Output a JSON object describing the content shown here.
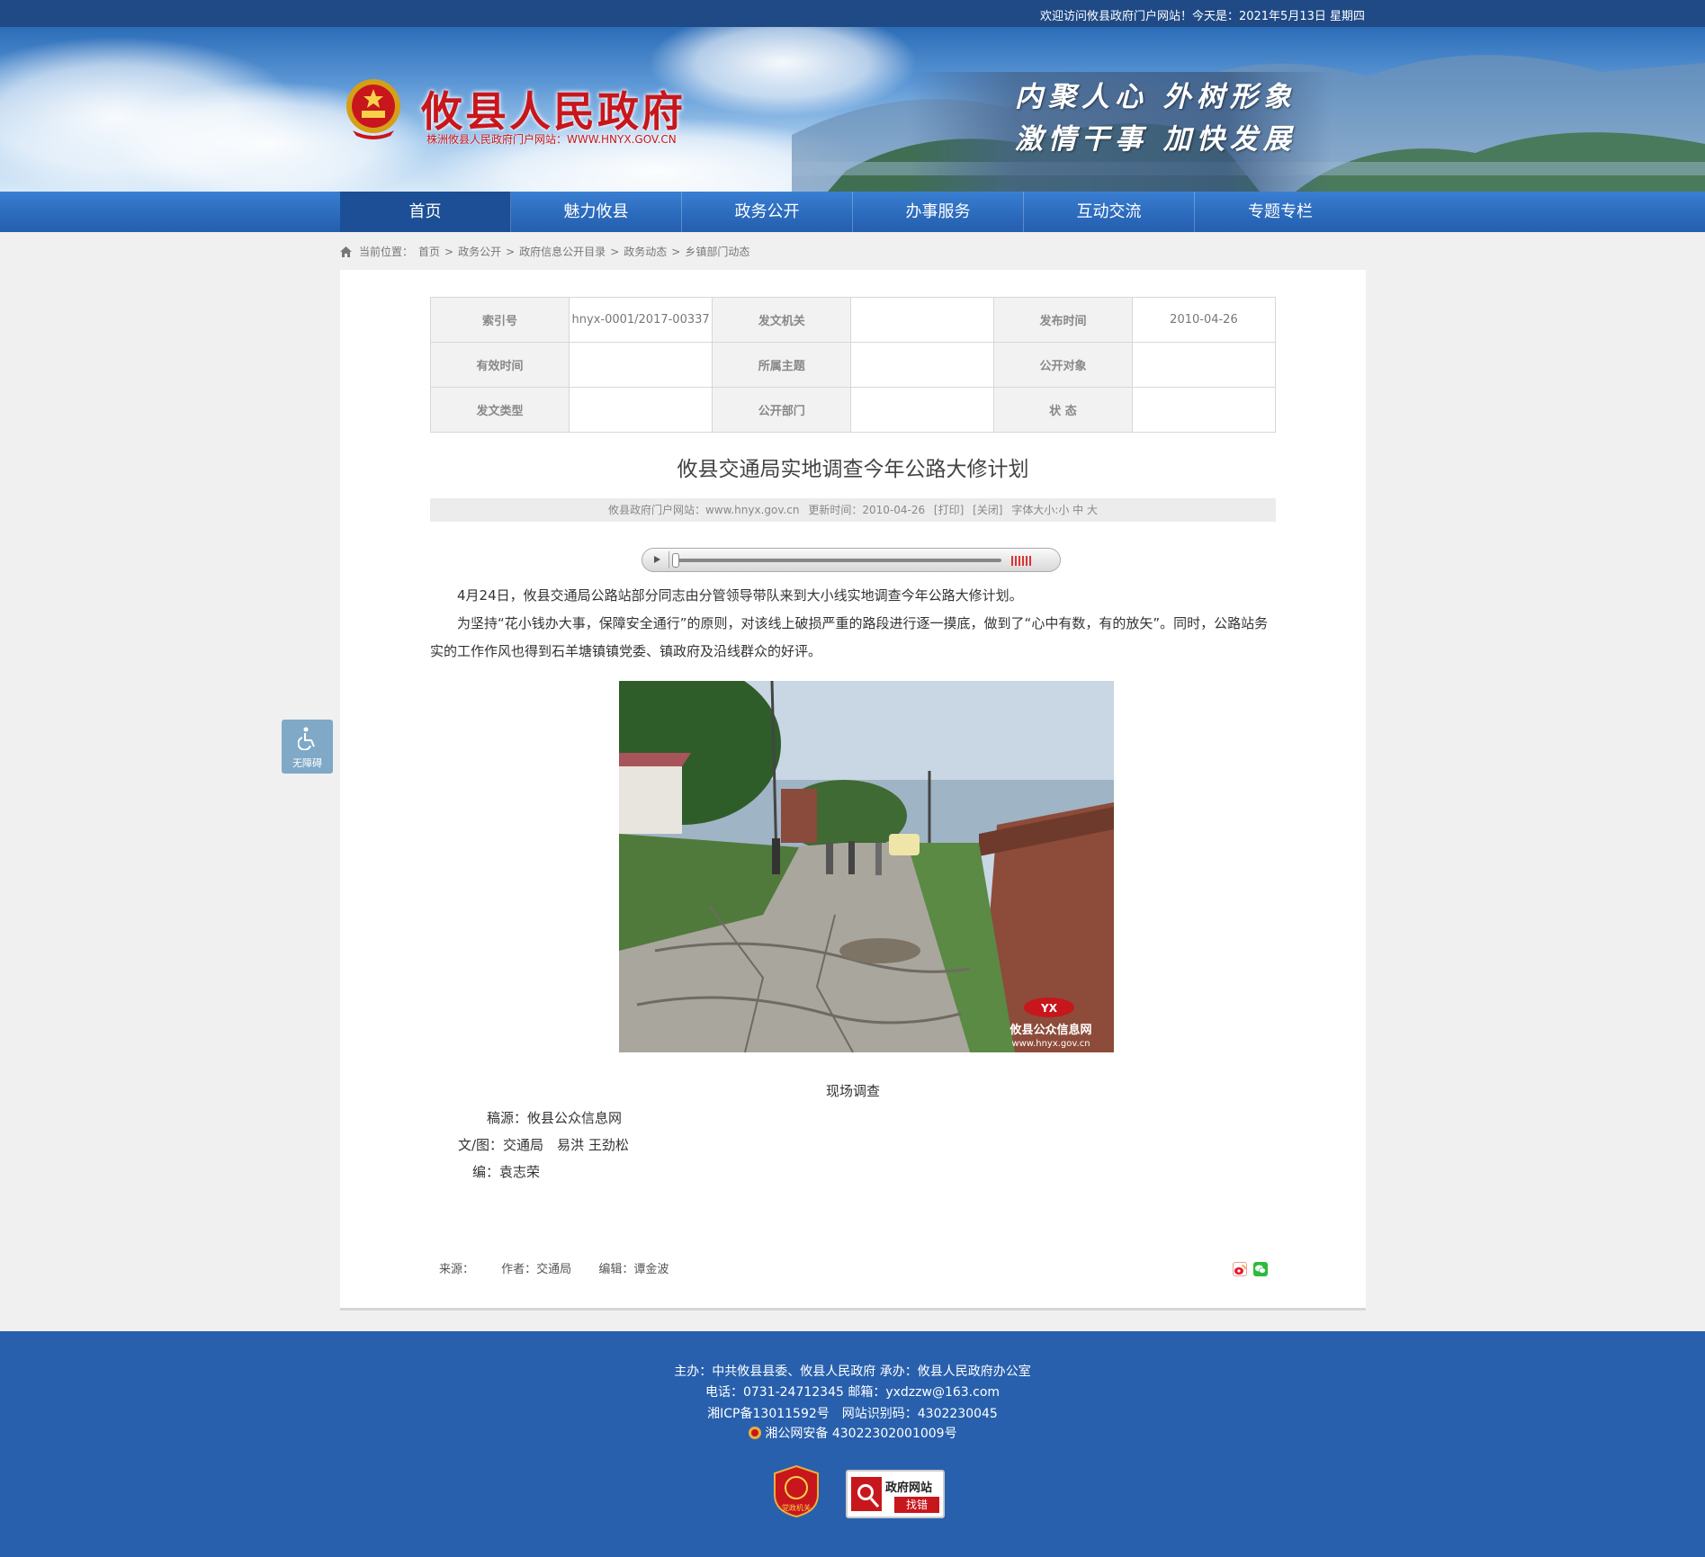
{
  "topbar": {
    "text": "欢迎访问攸县政府门户网站！今天是：2021年5月13日 星期四"
  },
  "header": {
    "site_title": "攸县人民政府",
    "site_subtitle": "株洲攸县人民政府门户网站：WWW.HNYX.GOV.CN",
    "slogan_line1": "内聚人心  外树形象",
    "slogan_line2": "激情干事  加快发展"
  },
  "nav": {
    "items": [
      {
        "label": "首页"
      },
      {
        "label": "魅力攸县"
      },
      {
        "label": "政务公开"
      },
      {
        "label": "办事服务"
      },
      {
        "label": "互动交流"
      },
      {
        "label": "专题专栏"
      }
    ]
  },
  "breadcrumb": {
    "prefix": "当前位置：",
    "items": [
      "首页",
      "政务公开",
      "政府信息公开目录",
      "政务动态",
      "乡镇部门动态"
    ],
    "separator": ">"
  },
  "meta": {
    "row1": {
      "k1": "索引号",
      "v1": "hnyx-0001/2017-00337",
      "k2": "发文机关",
      "v2": "",
      "k3": "发布时间",
      "v3": "2010-04-26"
    },
    "row2": {
      "k1": "有效时间",
      "v1": "",
      "k2": "所属主题",
      "v2": "",
      "k3": "公开对象",
      "v3": ""
    },
    "row3": {
      "k1": "发文类型",
      "v1": "",
      "k2": "公开部门",
      "v2": "",
      "k3": "状 态",
      "v3": ""
    }
  },
  "article": {
    "title": "攸县交通局实地调查今年公路大修计划",
    "source_site": "攸县政府门户网站：www.hnyx.gov.cn",
    "update_time": "更新时间：2010-04-26",
    "print": "[打印]",
    "close": "[关闭]",
    "font_size": "字体大小:小 中 大",
    "para1": "4月24日，攸县交通局公路站部分同志由分管领导带队来到大小线实地调查今年公路大修计划。",
    "para2": "为坚持“花小钱办大事，保障安全通行”的原则，对该线上破损严重的路段进行逐一摸底，做到了“心中有数，有的放矢”。同时，公路站务实的工作作风也得到石羊塘镇镇党委、镇政府及沿线群众的好评。",
    "photo_watermark": "攸县公众信息网",
    "photo_watermark_url": "www.hnyx.gov.cn",
    "caption": "现场调查",
    "credit_source": "稿源：攸县公众信息网",
    "credit_author": "文/图：交通局　易洪 王劲松",
    "credit_editor": "编：袁志荣"
  },
  "article_footer": {
    "source": "来源：",
    "author": "作者：交通局",
    "editor": "编辑：谭金波"
  },
  "accessibility": {
    "label": "无障碍"
  },
  "footer": {
    "line1": "主办：中共攸县县委、攸县人民政府 承办：攸县人民政府办公室",
    "line2": "电话：0731-24712345 邮箱：yxdzzw@163.com",
    "line3": "湘ICP备13011592号　网站识别码：4302230045",
    "line4": "湘公网安备 43022302001009号",
    "badge_party": "党政机关",
    "badge_error_title": "政府网站",
    "badge_error_sub": "找错"
  },
  "colors": {
    "topbar": "#1f4a86",
    "nav": "#2c6bbd",
    "nav_active": "#1c4f95",
    "footer": "#2860ad",
    "title_red": "#c8161d"
  }
}
